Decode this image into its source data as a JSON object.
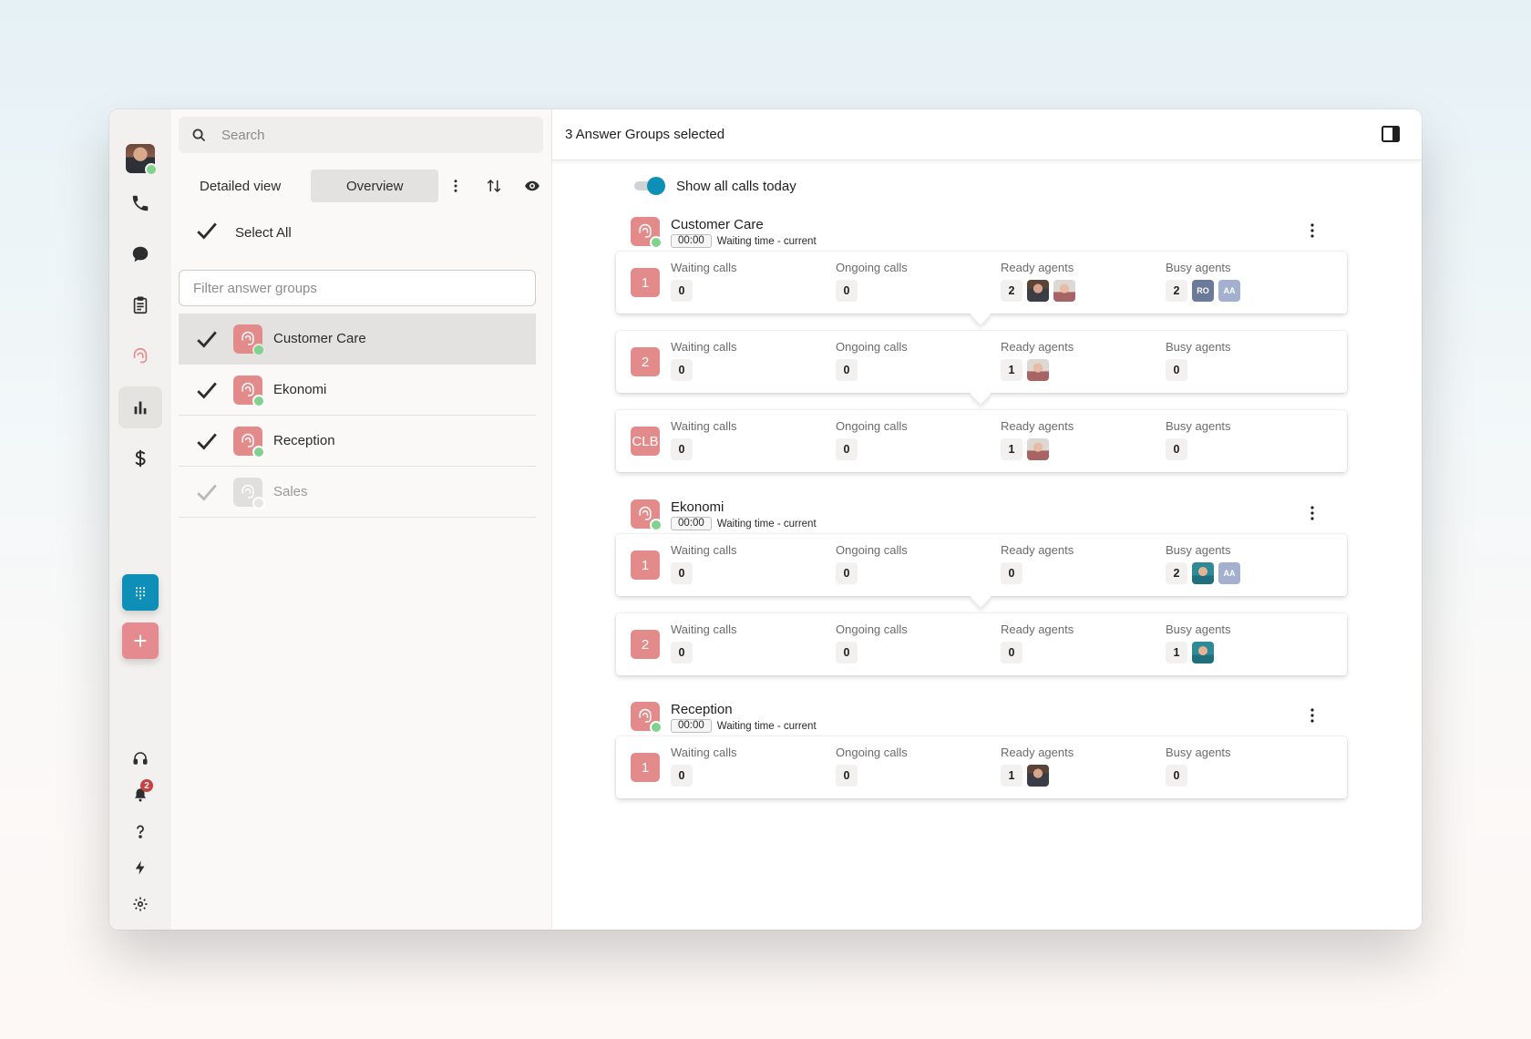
{
  "sidebar": {
    "nav": [
      "phone-icon",
      "chat-icon",
      "clipboard-icon",
      "answer-group-icon",
      "chart-icon",
      "dollar-icon"
    ],
    "bottom": [
      "headset-icon",
      "bell-icon",
      "help-icon",
      "lightning-icon",
      "gear-icon"
    ],
    "notification_count": "2"
  },
  "mid": {
    "search_placeholder": "Search",
    "view_detailed": "Detailed view",
    "view_overview": "Overview",
    "select_all": "Select All",
    "filter_placeholder": "Filter answer groups",
    "groups": [
      {
        "name": "Customer Care",
        "checked": true,
        "selected": true
      },
      {
        "name": "Ekonomi",
        "checked": true,
        "selected": false
      },
      {
        "name": "Reception",
        "checked": true,
        "selected": false
      },
      {
        "name": "Sales",
        "checked": false,
        "selected": false
      }
    ]
  },
  "main": {
    "title": "3 Answer Groups selected",
    "toggle_label": "Show all calls today",
    "labels": {
      "waiting": "Waiting calls",
      "ongoing": "Ongoing calls",
      "ready": "Ready agents",
      "busy": "Busy agents",
      "wait_sub": "Waiting time - current"
    },
    "answer_groups": [
      {
        "name": "Customer Care",
        "time": "00:00",
        "levels": [
          {
            "label": "1",
            "waiting": "0",
            "ongoing": "0",
            "ready": "2",
            "busy": "2"
          },
          {
            "label": "2",
            "waiting": "0",
            "ongoing": "0",
            "ready": "1",
            "busy": "0"
          },
          {
            "label": "CLB",
            "waiting": "0",
            "ongoing": "0",
            "ready": "1",
            "busy": "0"
          }
        ]
      },
      {
        "name": "Ekonomi",
        "time": "00:00",
        "levels": [
          {
            "label": "1",
            "waiting": "0",
            "ongoing": "0",
            "ready": "0",
            "busy": "2"
          },
          {
            "label": "2",
            "waiting": "0",
            "ongoing": "0",
            "ready": "0",
            "busy": "1"
          }
        ]
      },
      {
        "name": "Reception",
        "time": "00:00",
        "levels": [
          {
            "label": "1",
            "waiting": "0",
            "ongoing": "0",
            "ready": "1",
            "busy": "0"
          }
        ]
      }
    ],
    "avatar_initials": {
      "ro": "RO",
      "aa": "AA"
    }
  },
  "colors": {
    "accent": "#0e8fb8",
    "group": "#e38b8b",
    "online": "#7fd38c",
    "badge": "#c94040"
  }
}
